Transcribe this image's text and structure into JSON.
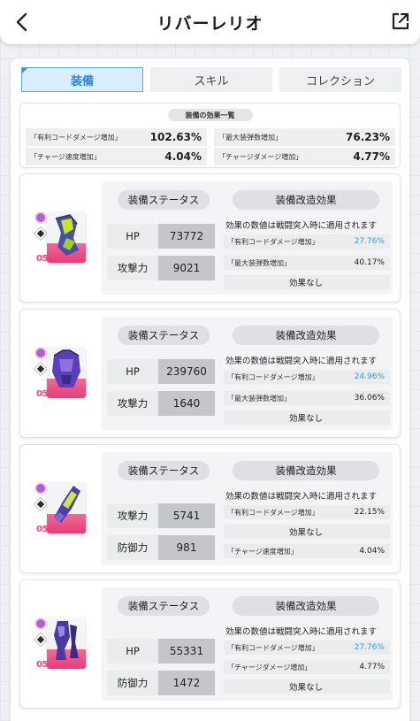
{
  "header": {
    "title": "リバーレリオ"
  },
  "tabs": [
    {
      "label": "装備",
      "active": true
    },
    {
      "label": "スキル",
      "active": false
    },
    {
      "label": "コレクション",
      "active": false
    }
  ],
  "summary": {
    "title": "装備の効果一覧",
    "items": [
      {
        "label": "「有利コードダメージ増加」",
        "value": "102.63%"
      },
      {
        "label": "「最大装弾数増加」",
        "value": "76.23%"
      },
      {
        "label": "「チャージ速度増加」",
        "value": "4.04%"
      },
      {
        "label": "「チャージダメージ増加」",
        "value": "4.77%"
      }
    ]
  },
  "common": {
    "status_header": "装備ステータス",
    "mod_header": "装備改造効果",
    "note": "効果の数値は戦闘突入時に適用されます",
    "tier": "05",
    "none": "効果なし"
  },
  "colors": {
    "accent": "#2b7fd8",
    "highlight": "#2e9bea",
    "rarity": "#b35fd1",
    "tier": "#ff3e80"
  },
  "equipment": [
    {
      "slot": "head",
      "stats": [
        {
          "label": "HP",
          "value": "73772"
        },
        {
          "label": "攻撃力",
          "value": "9021"
        }
      ],
      "effects": [
        {
          "label": "「有利コードダメージ増加」",
          "value": "27.76%",
          "highlight": true
        },
        {
          "label": "「最大装弾数増加」",
          "value": "40.17%",
          "highlight": false
        },
        {
          "label": "効果なし",
          "value": "",
          "highlight": false
        }
      ]
    },
    {
      "slot": "torso",
      "stats": [
        {
          "label": "HP",
          "value": "239760"
        },
        {
          "label": "攻撃力",
          "value": "1640"
        }
      ],
      "effects": [
        {
          "label": "「有利コードダメージ増加」",
          "value": "24.96%",
          "highlight": true
        },
        {
          "label": "「最大装弾数増加」",
          "value": "36.06%",
          "highlight": false
        },
        {
          "label": "効果なし",
          "value": "",
          "highlight": false
        }
      ]
    },
    {
      "slot": "arm",
      "stats": [
        {
          "label": "攻撃力",
          "value": "5741"
        },
        {
          "label": "防御力",
          "value": "981"
        }
      ],
      "effects": [
        {
          "label": "「有利コードダメージ増加」",
          "value": "22.15%",
          "highlight": false
        },
        {
          "label": "効果なし",
          "value": "",
          "highlight": false
        },
        {
          "label": "「チャージ速度増加」",
          "value": "4.04%",
          "highlight": false
        }
      ]
    },
    {
      "slot": "leg",
      "stats": [
        {
          "label": "HP",
          "value": "55331"
        },
        {
          "label": "防御力",
          "value": "1472"
        }
      ],
      "effects": [
        {
          "label": "「有利コードダメージ増加」",
          "value": "27.76%",
          "highlight": true
        },
        {
          "label": "「チャージダメージ増加」",
          "value": "4.77%",
          "highlight": false
        },
        {
          "label": "効果なし",
          "value": "",
          "highlight": false
        }
      ]
    }
  ]
}
